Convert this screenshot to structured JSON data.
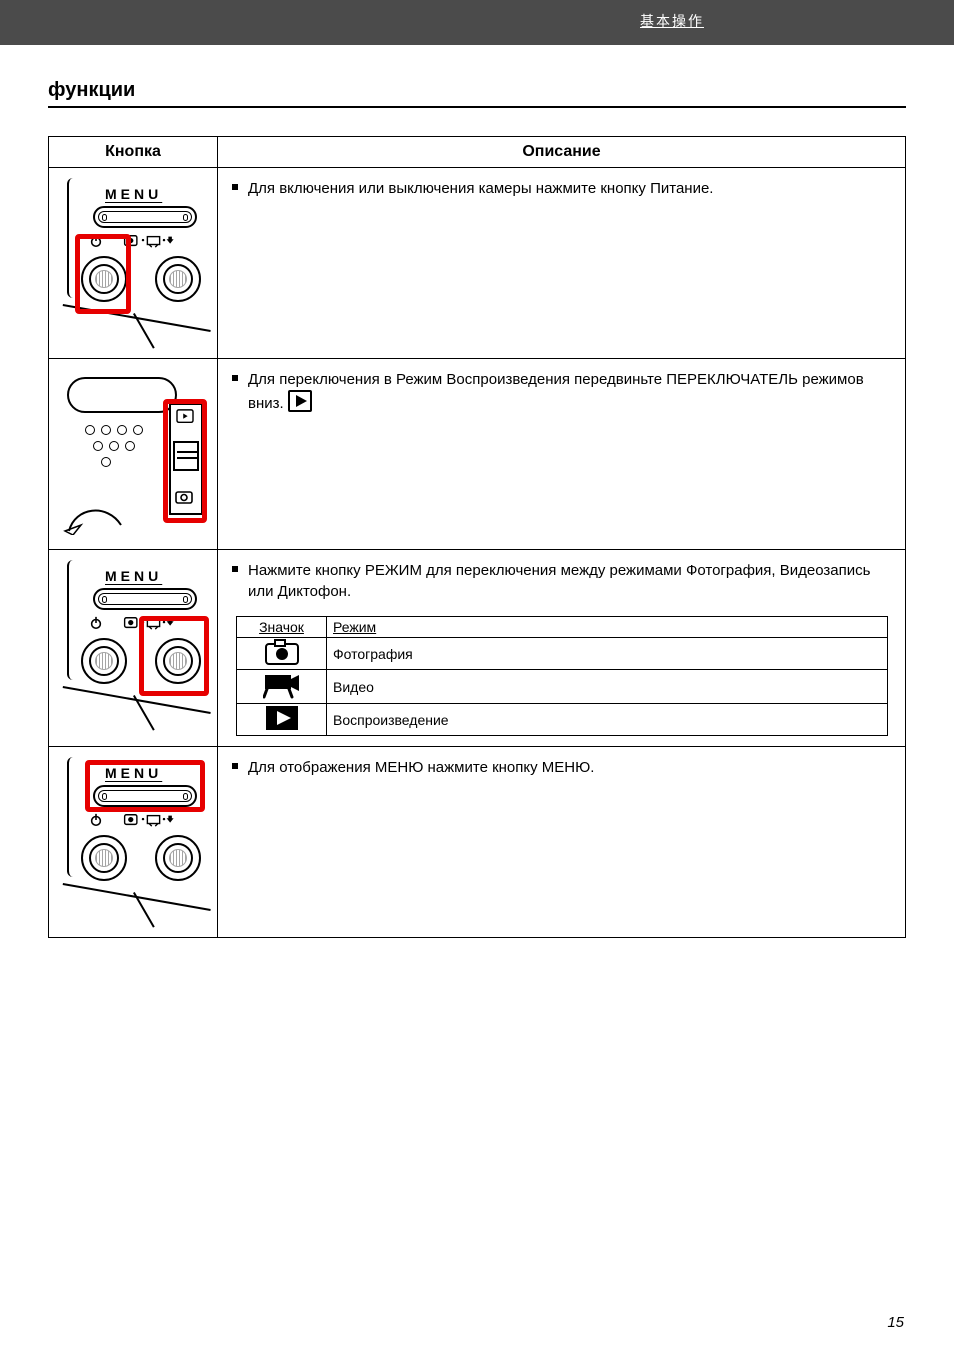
{
  "topbar": {
    "corner_text": "基本操作"
  },
  "section_title": "функции",
  "header": {
    "button_col": "Кнопка",
    "desc_col": "Описание"
  },
  "rows": [
    {
      "image": "menu_power_hilite",
      "bullets": [
        "Для включения или выключения камеры нажмите кнопку Питание."
      ]
    },
    {
      "image": "slider_hilite",
      "bullets": [
        "Для переключения в Режим Воспроизведения передвиньте ПЕРЕКЛЮЧАТЕЛЬ режимов вниз."
      ],
      "inline_play_icon_after": 0
    },
    {
      "image": "menu_mode_hilite",
      "bullets": [
        "Нажмите кнопку РЕЖИМ для переключения между режимами Фотография, Видеозапись или Диктофон."
      ],
      "inner_table": {
        "headers": [
          "Значок",
          "Режим"
        ],
        "rows": [
          {
            "icon": "camera_icon",
            "label": "Фотография"
          },
          {
            "icon": "camcorder_icon",
            "label": "Видео"
          },
          {
            "icon": "play_icon",
            "label": "Воспроизведение"
          }
        ]
      }
    },
    {
      "image": "menu_bar_hilite",
      "bullets": [
        "Для отображения МЕНЮ нажмите кнопку МЕНЮ."
      ]
    }
  ],
  "footer_page": "15"
}
